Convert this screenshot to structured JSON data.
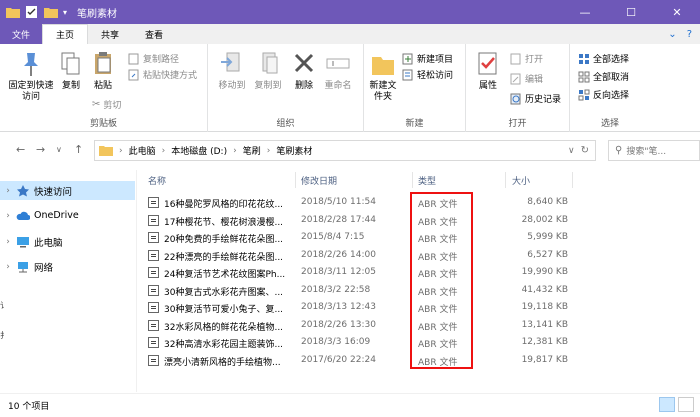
{
  "window": {
    "title": "笔刷素材",
    "controls": {
      "minimize": "—",
      "maximize": "☐",
      "close": "✕"
    }
  },
  "ribbon_tabs": {
    "file": "文件",
    "items": [
      "主页",
      "共享",
      "查看"
    ]
  },
  "ribbon": {
    "clipboard": {
      "group_label": "剪贴板",
      "pin_label": "固定到快速访问",
      "copy_label": "复制",
      "paste_label": "粘贴",
      "copy_path": "复制路径",
      "paste_shortcut": "粘贴快捷方式",
      "cut": "剪切"
    },
    "organize": {
      "group_label": "组织",
      "move_to": "移动到",
      "copy_to": "复制到",
      "delete": "删除",
      "rename": "重命名"
    },
    "new": {
      "group_label": "新建",
      "new_folder": "新建文件夹",
      "new_item": "新建项目",
      "easy_access": "轻松访问"
    },
    "open": {
      "group_label": "打开",
      "properties": "属性",
      "open": "打开",
      "edit": "编辑",
      "history": "历史记录"
    },
    "select": {
      "group_label": "选择",
      "select_all": "全部选择",
      "select_none": "全部取消",
      "invert": "反向选择"
    }
  },
  "address": {
    "path": [
      "此电脑",
      "本地磁盘 (D:)",
      "笔刷",
      "笔刷素材"
    ],
    "search_placeholder": "搜索\"笔..."
  },
  "sidebar": {
    "items": [
      {
        "label": "快速访问",
        "selected": true
      },
      {
        "label": "OneDrive",
        "selected": false
      },
      {
        "label": "此电脑",
        "selected": false
      },
      {
        "label": "网络",
        "selected": false
      }
    ]
  },
  "columns": {
    "name": "名称",
    "date": "修改日期",
    "type": "类型",
    "size": "大小"
  },
  "files": [
    {
      "name": "16种曼陀罗风格的印花花纹...",
      "date": "2018/5/10 11:54",
      "type": "ABR 文件",
      "size": "8,640 KB"
    },
    {
      "name": "17种樱花节、樱花树浪漫樱...",
      "date": "2018/2/28 17:44",
      "type": "ABR 文件",
      "size": "28,002 KB"
    },
    {
      "name": "20种免费的手绘鲜花花朵图...",
      "date": "2015/8/4 7:15",
      "type": "ABR 文件",
      "size": "5,999 KB"
    },
    {
      "name": "22种漂亮的手绘鲜花花朵图...",
      "date": "2018/2/26 14:00",
      "type": "ABR 文件",
      "size": "6,527 KB"
    },
    {
      "name": "24种复活节艺术花纹图案Ph...",
      "date": "2018/3/11 12:05",
      "type": "ABR 文件",
      "size": "19,990 KB"
    },
    {
      "name": "30种复古式水彩花卉图案、...",
      "date": "2018/3/2 22:58",
      "type": "ABR 文件",
      "size": "41,432 KB"
    },
    {
      "name": "30种复活节可爱小兔子、复...",
      "date": "2018/3/13 12:43",
      "type": "ABR 文件",
      "size": "19,118 KB"
    },
    {
      "name": "32水彩风格的鲜花花朵植物...",
      "date": "2018/2/26 13:30",
      "type": "ABR 文件",
      "size": "13,141 KB"
    },
    {
      "name": "32种高清水彩花园主题装饰...",
      "date": "2018/3/3 16:09",
      "type": "ABR 文件",
      "size": "12,381 KB"
    },
    {
      "name": "漂亮小清新风格的手绘植物...",
      "date": "2017/6/20 22:24",
      "type": "ABR 文件",
      "size": "19,817 KB"
    }
  ],
  "status": {
    "count": "10 个项目"
  },
  "colors": {
    "accent": "#6e58b8",
    "selection": "#cce8ff",
    "highlight_box": "#e11111"
  }
}
